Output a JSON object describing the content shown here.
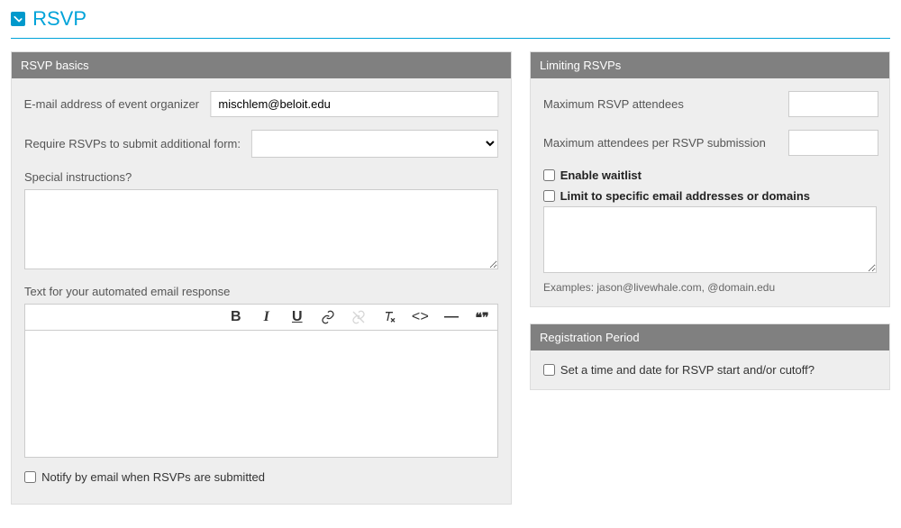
{
  "header": {
    "title": "RSVP"
  },
  "basics": {
    "panel_title": "RSVP basics",
    "email_label": "E-mail address of event organizer",
    "email_value": "mischlem@beloit.edu",
    "require_form_label": "Require RSVPs to submit additional form:",
    "require_form_value": "",
    "special_instructions_label": "Special instructions?",
    "special_instructions_value": "",
    "automated_text_label": "Text for your automated email response",
    "notify_label": "Notify by email when RSVPs are submitted"
  },
  "toolbar": {
    "bold": "B",
    "italic": "I",
    "underline": "U",
    "embed": "<>",
    "hr": "—",
    "quote": "❝❞"
  },
  "limiting": {
    "panel_title": "Limiting RSVPs",
    "max_attendees_label": "Maximum RSVP attendees",
    "max_attendees_value": "",
    "max_per_submission_label": "Maximum attendees per RSVP submission",
    "max_per_submission_value": "",
    "enable_waitlist_label": "Enable waitlist",
    "limit_domains_label": "Limit to specific email addresses or domains",
    "examples_text": "Examples: jason@livewhale.com, @domain.edu"
  },
  "registration": {
    "panel_title": "Registration Period",
    "set_time_label": "Set a time and date for RSVP start and/or cutoff?"
  }
}
